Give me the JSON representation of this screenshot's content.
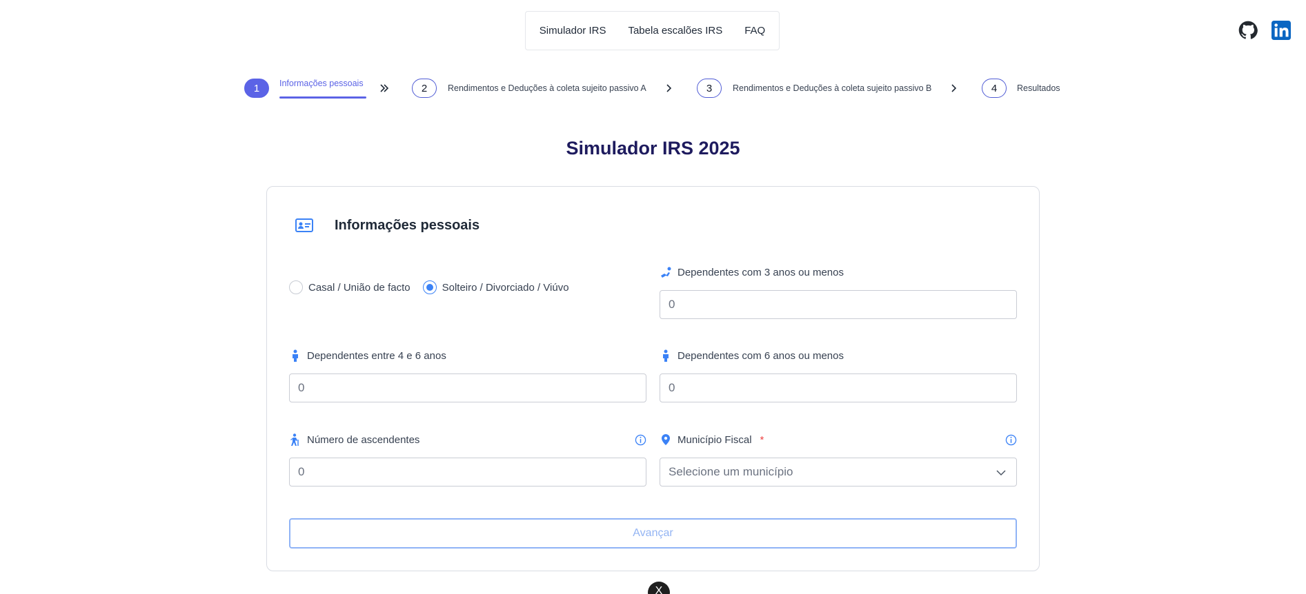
{
  "nav": {
    "items": [
      {
        "label": "Simulador IRS"
      },
      {
        "label": "Tabela escalões IRS"
      },
      {
        "label": "FAQ"
      }
    ],
    "github_icon": "github-icon",
    "linkedin_icon": "linkedin-icon"
  },
  "stepper": {
    "steps": [
      {
        "number": "1",
        "label": "Informações pessoais",
        "active": true
      },
      {
        "number": "2",
        "label": "Rendimentos e Deduções à coleta sujeito passivo A",
        "active": false
      },
      {
        "number": "3",
        "label": "Rendimentos e Deduções à coleta sujeito passivo B",
        "active": false
      },
      {
        "number": "4",
        "label": "Resultados",
        "active": false
      }
    ]
  },
  "page": {
    "title": "Simulador IRS 2025"
  },
  "card": {
    "title": "Informações pessoais",
    "icon": "id-card-icon",
    "civil_status": {
      "options": [
        {
          "label": "Casal / União de facto",
          "checked": false
        },
        {
          "label": "Solteiro / Divorciado / Viúvo",
          "checked": true
        }
      ]
    },
    "fields": {
      "dep_3": {
        "label": "Dependentes com 3 anos ou menos",
        "value": "0",
        "icon": "baby-icon"
      },
      "dep_4_6": {
        "label": "Dependentes entre 4 e 6 anos",
        "value": "0",
        "icon": "child-icon"
      },
      "dep_6": {
        "label": "Dependentes com 6 anos ou menos",
        "value": "0",
        "icon": "child-icon"
      },
      "ascendentes": {
        "label": "Número de ascendentes",
        "value": "0",
        "icon": "elderly-icon"
      },
      "municipio": {
        "label": "Município Fiscal",
        "required_mark": "*",
        "placeholder": "Selecione um município",
        "icon": "map-pin-icon"
      }
    },
    "submit_label": "Avançar"
  },
  "colors": {
    "accent": "#5b63e6",
    "primary_blue": "#3b82f6",
    "title": "#1e1b5e"
  },
  "floating_badge": "X"
}
